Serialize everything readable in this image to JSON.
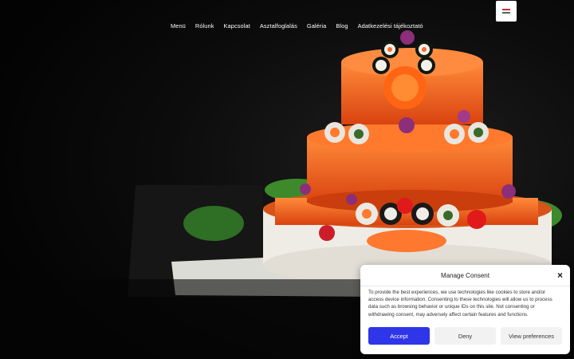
{
  "nav": {
    "items": [
      "Menü",
      "Rólunk",
      "Kapcsolat",
      "Asztalfoglalás",
      "Galéria",
      "Blog",
      "Adatkezelési tájékoztató"
    ]
  },
  "language": {
    "flag_colors": [
      "#ce2939",
      "#ffffff",
      "#477050"
    ]
  },
  "consent": {
    "title": "Manage Consent",
    "text": "To provide the best experiences, we use technologies like cookies to store and/or access device information. Consenting to these technologies will allow us to process data such as browsing behavior or unique IDs on this site. Not consenting or withdrawing consent, may adversely affect certain features and functions.",
    "accept_label": "Accept",
    "deny_label": "Deny",
    "preferences_label": "View preferences",
    "close_icon": "×",
    "accent_color": "#2f35e8"
  }
}
